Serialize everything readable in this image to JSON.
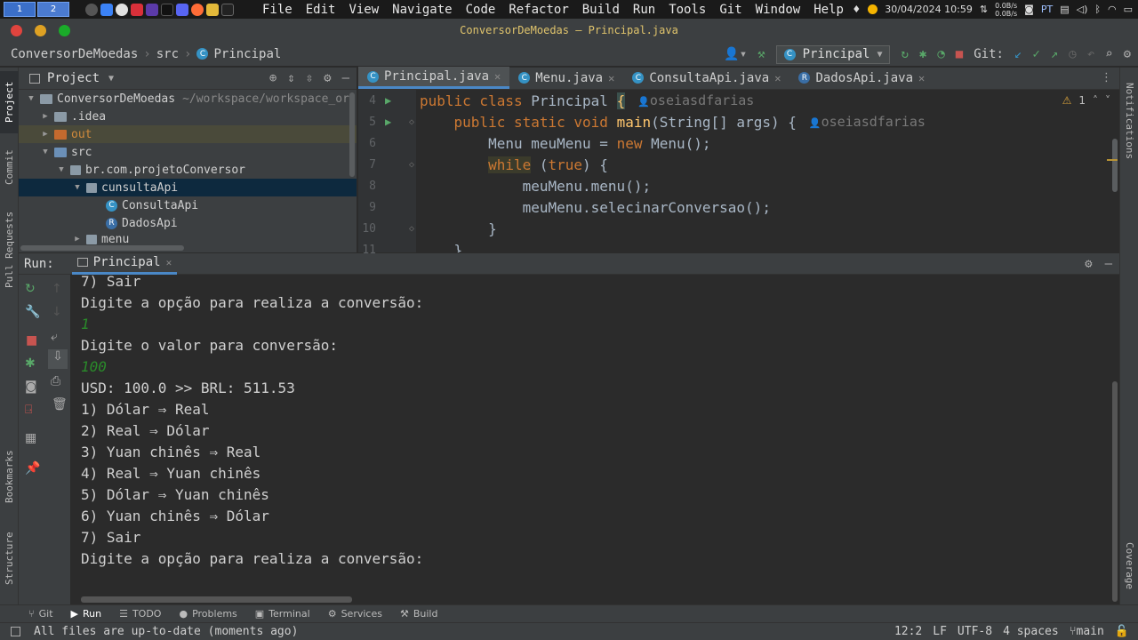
{
  "system": {
    "workspace1": "1",
    "workspace2": "2",
    "menus": [
      "File",
      "Edit",
      "View",
      "Navigate",
      "Code",
      "Refactor",
      "Build",
      "Run",
      "Tools",
      "Git",
      "Window",
      "Help"
    ],
    "datetime": "30/04/2024 10:59",
    "net_up": "0.0B/s",
    "net_down": "0.0B/s",
    "lang": "PT"
  },
  "window": {
    "title": "ConversorDeMoedas – Principal.java"
  },
  "navbar": {
    "crumb_project": "ConversorDeMoedas",
    "crumb_src": "src",
    "crumb_class": "Principal",
    "run_config": "Principal",
    "git_label": "Git:"
  },
  "project": {
    "header": "Project",
    "items": [
      {
        "label": "ConversorDeMoedas",
        "suffix": "~/workspace/workspace_or"
      },
      {
        "label": ".idea"
      },
      {
        "label": "out"
      },
      {
        "label": "src"
      },
      {
        "label": "br.com.projetoConversor"
      },
      {
        "label": "cunsultaApi"
      },
      {
        "label": "ConsultaApi"
      },
      {
        "label": "DadosApi"
      },
      {
        "label": "menu"
      }
    ]
  },
  "editor": {
    "tabs": [
      "Principal.java",
      "Menu.java",
      "ConsultaApi.java",
      "DadosApi.java"
    ],
    "line_numbers": [
      "4",
      "5",
      "6",
      "7",
      "8",
      "9",
      "10",
      "11"
    ],
    "author": "oseiasdfarias",
    "warning_count": "1",
    "code": {
      "l4_a": "public class ",
      "l4_b": "Principal ",
      "l4_c": "{",
      "l5_a": "    public static void ",
      "l5_b": "main",
      "l5_c": "(String[] args) {",
      "l6_a": "        Menu meuMenu = ",
      "l6_b": "new ",
      "l6_c": "Menu();",
      "l7_a": "        ",
      "l7_b": "while",
      "l7_c": " (",
      "l7_d": "true",
      "l7_e": ") {",
      "l8": "            meuMenu.menu();",
      "l9": "            meuMenu.selecinarConversao();",
      "l10": "        }",
      "l11": "    }"
    }
  },
  "run": {
    "label": "Run:",
    "tab": "Principal",
    "console": [
      {
        "text": "7) Sair",
        "input": false
      },
      {
        "text": "Digite a opção para realiza a conversão:",
        "input": false
      },
      {
        "text": "1",
        "input": true
      },
      {
        "text": "Digite o valor para conversão:",
        "input": false
      },
      {
        "text": "100",
        "input": true
      },
      {
        "text": "USD: 100.0 >> BRL: 511.53",
        "input": false
      },
      {
        "text": "1) Dólar ⇒ Real",
        "input": false
      },
      {
        "text": "2) Real ⇒ Dólar",
        "input": false
      },
      {
        "text": "3) Yuan chinês ⇒ Real",
        "input": false
      },
      {
        "text": "4) Real ⇒ Yuan chinês",
        "input": false
      },
      {
        "text": "5) Dólar ⇒ Yuan chinês",
        "input": false
      },
      {
        "text": "6) Yuan chinês ⇒ Dólar",
        "input": false
      },
      {
        "text": "7) Sair",
        "input": false
      },
      {
        "text": "Digite a opção para realiza a conversão:",
        "input": false
      }
    ]
  },
  "side_tabs": {
    "project": "Project",
    "commit": "Commit",
    "pull_requests": "Pull Requests",
    "bookmarks": "Bookmarks",
    "structure": "Structure",
    "notifications": "Notifications",
    "coverage": "Coverage"
  },
  "bottom_tabs": [
    "Git",
    "Run",
    "TODO",
    "Problems",
    "Terminal",
    "Services",
    "Build"
  ],
  "status": {
    "message": "All files are up-to-date (moments ago)",
    "position": "12:2",
    "line_sep": "LF",
    "encoding": "UTF-8",
    "indent": "4 spaces",
    "branch": "main"
  }
}
